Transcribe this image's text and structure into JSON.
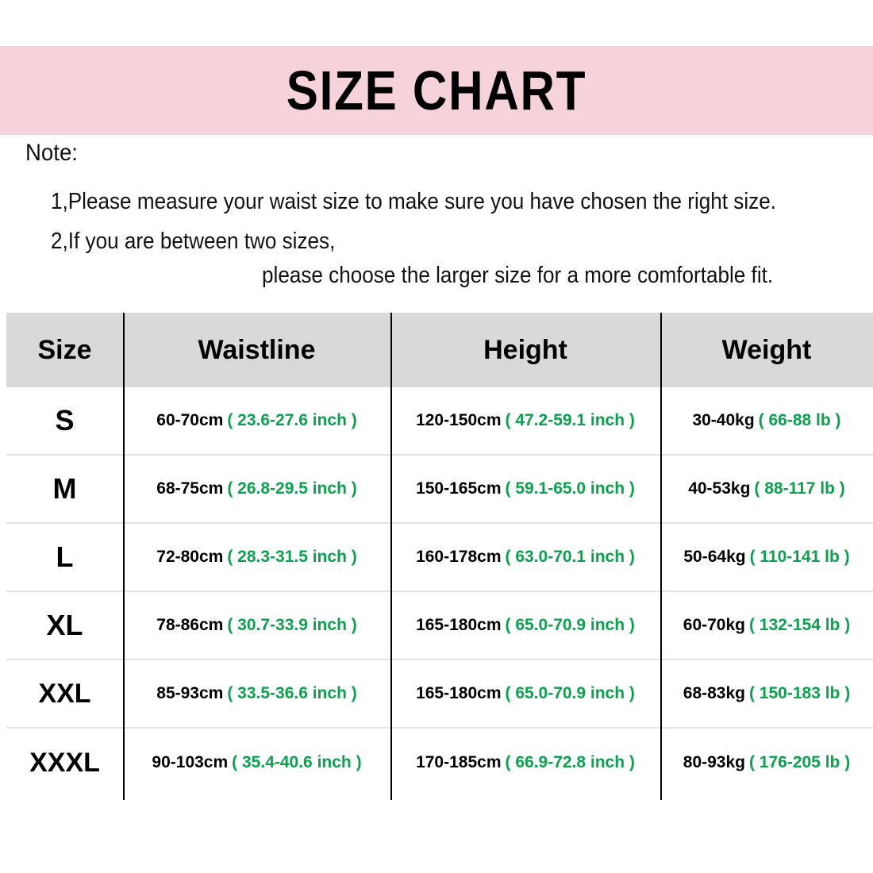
{
  "title": "SIZE CHART",
  "colors": {
    "banner_pink": "#F6D2DA",
    "header_gray": "#D9D9D9",
    "imperial_green": "#0AA24C",
    "text_black": "#000000"
  },
  "notes": {
    "label": "Note:",
    "line1": "1,Please measure your waist size to make sure you have chosen the right size.",
    "line2": "2,If you are between two sizes,",
    "line3": "please choose the larger size for a more comfortable fit."
  },
  "table": {
    "headers": {
      "size": "Size",
      "waistline": "Waistline",
      "height": "Height",
      "weight": "Weight"
    },
    "rows": [
      {
        "size": "S",
        "waist_cm": "60-70cm",
        "waist_in": "( 23.6-27.6 inch )",
        "height_cm": "120-150cm",
        "height_in": "( 47.2-59.1 inch )",
        "weight_kg": "30-40kg",
        "weight_lb": "( 66-88 lb )"
      },
      {
        "size": "M",
        "waist_cm": "68-75cm",
        "waist_in": "( 26.8-29.5 inch )",
        "height_cm": "150-165cm",
        "height_in": "( 59.1-65.0 inch )",
        "weight_kg": "40-53kg",
        "weight_lb": "( 88-117 lb )"
      },
      {
        "size": "L",
        "waist_cm": "72-80cm",
        "waist_in": "( 28.3-31.5 inch )",
        "height_cm": "160-178cm",
        "height_in": "( 63.0-70.1 inch )",
        "weight_kg": "50-64kg",
        "weight_lb": "( 110-141 lb )"
      },
      {
        "size": "XL",
        "waist_cm": "78-86cm",
        "waist_in": "( 30.7-33.9 inch )",
        "height_cm": "165-180cm",
        "height_in": "( 65.0-70.9 inch )",
        "weight_kg": "60-70kg",
        "weight_lb": "( 132-154 lb )"
      },
      {
        "size": "XXL",
        "waist_cm": "85-93cm",
        "waist_in": "( 33.5-36.6 inch )",
        "height_cm": "165-180cm",
        "height_in": "( 65.0-70.9 inch )",
        "weight_kg": "68-83kg",
        "weight_lb": "( 150-183 lb )"
      },
      {
        "size": "XXXL",
        "waist_cm": "90-103cm",
        "waist_in": "( 35.4-40.6 inch )",
        "height_cm": "170-185cm",
        "height_in": "( 66.9-72.8 inch )",
        "weight_kg": "80-93kg",
        "weight_lb": "( 176-205 lb )"
      }
    ]
  },
  "chart_data": {
    "type": "table",
    "title": "SIZE CHART",
    "columns": [
      "Size",
      "Waistline",
      "Height",
      "Weight"
    ],
    "rows": [
      [
        "S",
        "60-70cm ( 23.6-27.6 inch )",
        "120-150cm ( 47.2-59.1 inch )",
        "30-40kg ( 66-88 lb )"
      ],
      [
        "M",
        "68-75cm ( 26.8-29.5 inch )",
        "150-165cm ( 59.1-65.0 inch )",
        "40-53kg ( 88-117 lb )"
      ],
      [
        "L",
        "72-80cm ( 28.3-31.5 inch )",
        "160-178cm ( 63.0-70.1 inch )",
        "50-64kg ( 110-141 lb )"
      ],
      [
        "XL",
        "78-86cm ( 30.7-33.9 inch )",
        "165-180cm ( 65.0-70.9 inch )",
        "60-70kg ( 132-154 lb )"
      ],
      [
        "XXL",
        "85-93cm ( 33.5-36.6 inch )",
        "165-180cm ( 65.0-70.9 inch )",
        "68-83kg ( 150-183 lb )"
      ],
      [
        "XXXL",
        "90-103cm ( 35.4-40.6 inch )",
        "170-185cm ( 66.9-72.8 inch )",
        "80-93kg ( 176-205 lb )"
      ]
    ]
  }
}
